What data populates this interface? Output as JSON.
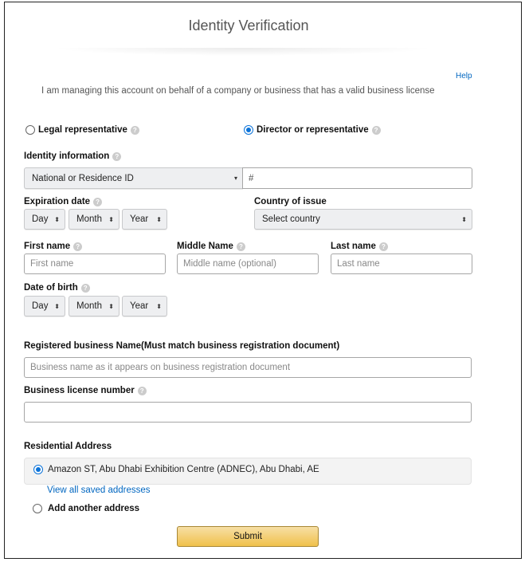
{
  "header": {
    "title": "Identity Verification",
    "help": "Help",
    "intro": "I am managing this account on behalf of a company or business that has a valid business license"
  },
  "role": {
    "legal": "Legal representative",
    "director": "Director or representative",
    "selected": "director"
  },
  "identity": {
    "label": "Identity information",
    "id_type": "National or Residence ID",
    "id_placeholder": "#"
  },
  "expiration": {
    "label": "Expiration date",
    "day": "Day",
    "month": "Month",
    "year": "Year"
  },
  "country": {
    "label": "Country of issue",
    "value": "Select country"
  },
  "names": {
    "first_label": "First name",
    "first_placeholder": "First name",
    "middle_label": "Middle Name",
    "middle_placeholder": "Middle name (optional)",
    "last_label": "Last name",
    "last_placeholder": "Last name"
  },
  "dob": {
    "label": "Date of birth",
    "day": "Day",
    "month": "Month",
    "year": "Year"
  },
  "business": {
    "name_label": "Registered business Name(Must match business registration document)",
    "name_placeholder": "Business name as it appears on business registration document",
    "license_label": "Business license number",
    "license_value": ""
  },
  "address": {
    "label": "Residential Address",
    "saved": "Amazon ST, Abu Dhabi Exhibition Centre (ADNEC), Abu Dhabi, AE",
    "view_all": "View all saved addresses",
    "add_another": "Add another address"
  },
  "submit": "Submit",
  "help_icon": "?"
}
